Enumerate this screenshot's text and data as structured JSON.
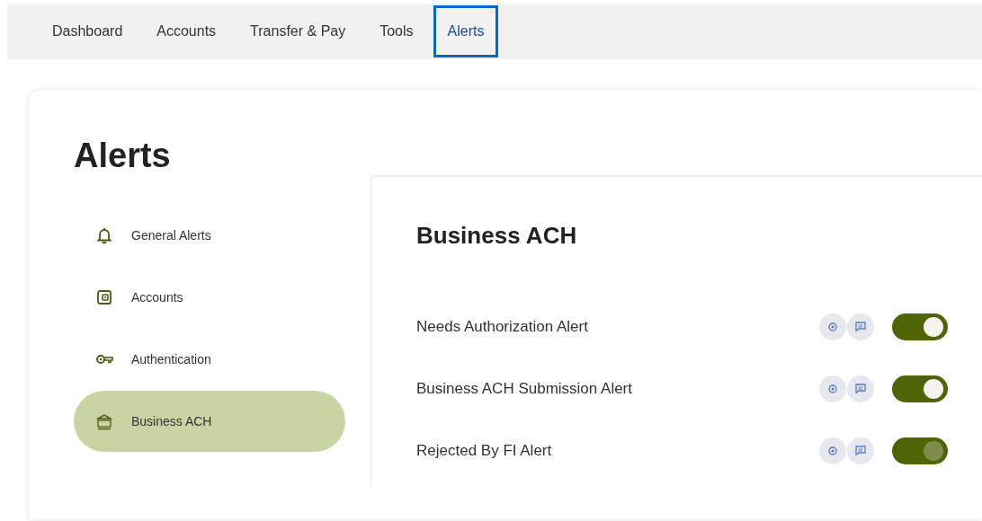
{
  "nav": [
    {
      "label": "Dashboard",
      "selected": false
    },
    {
      "label": "Accounts",
      "selected": false
    },
    {
      "label": "Transfer & Pay",
      "selected": false
    },
    {
      "label": "Tools",
      "selected": false
    },
    {
      "label": "Alerts",
      "selected": true
    }
  ],
  "page_title": "Alerts",
  "sidebar": {
    "items": [
      {
        "label": "General Alerts",
        "selected": false
      },
      {
        "label": "Accounts",
        "selected": false
      },
      {
        "label": "Authentication",
        "selected": false
      },
      {
        "label": "Business ACH",
        "selected": true
      }
    ]
  },
  "panel": {
    "title": "Business ACH",
    "alerts": [
      {
        "label": "Needs Authorization Alert",
        "on": true,
        "highlighted": false
      },
      {
        "label": "Business ACH Submission Alert",
        "on": true,
        "highlighted": false
      },
      {
        "label": "Rejected By FI Alert",
        "on": true,
        "highlighted": true
      }
    ]
  }
}
